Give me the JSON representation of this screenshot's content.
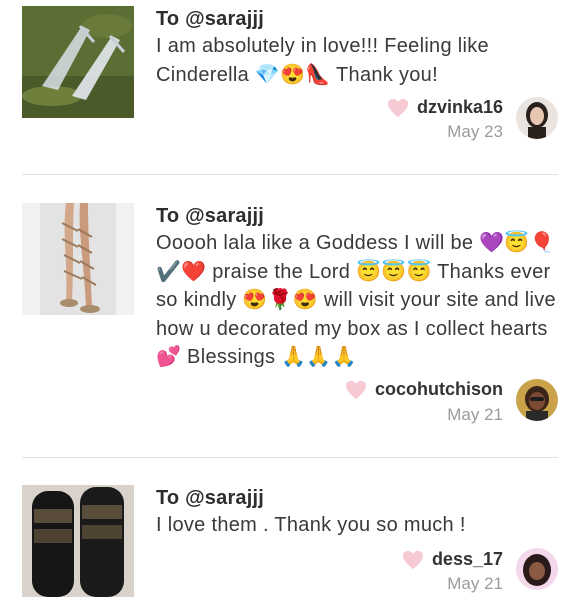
{
  "notes": [
    {
      "to": "To @sarajjj",
      "message": "I am absolutely in love!!! Feeling like Cinderella 💎😍👠 Thank you!",
      "sender": "dzvinka16",
      "date": "May 23",
      "thumb_icon": "clear-heels-photo",
      "avatar_icon": "user-avatar"
    },
    {
      "to": "To @sarajjj",
      "message": "Ooooh lala like a Goddess I will be 💜😇🎈✔️❤️ praise the Lord 😇😇😇 Thanks ever so kindly 😍🌹😍 will visit your site and live how u decorated my box as I collect hearts 💕 Blessings 🙏🙏🙏",
      "sender": "cocohutchison",
      "date": "May 21",
      "thumb_icon": "wrap-sandal-photo",
      "avatar_icon": "user-avatar"
    },
    {
      "to": "To @sarajjj",
      "message": "I love them . Thank you so much !",
      "sender": "dess_17",
      "date": "May 21",
      "thumb_icon": "glitter-slides-photo",
      "avatar_icon": "user-avatar"
    }
  ],
  "colors": {
    "heart": "#f7c9d3",
    "divider": "#e2e2e2",
    "date": "#9b9b9b"
  }
}
